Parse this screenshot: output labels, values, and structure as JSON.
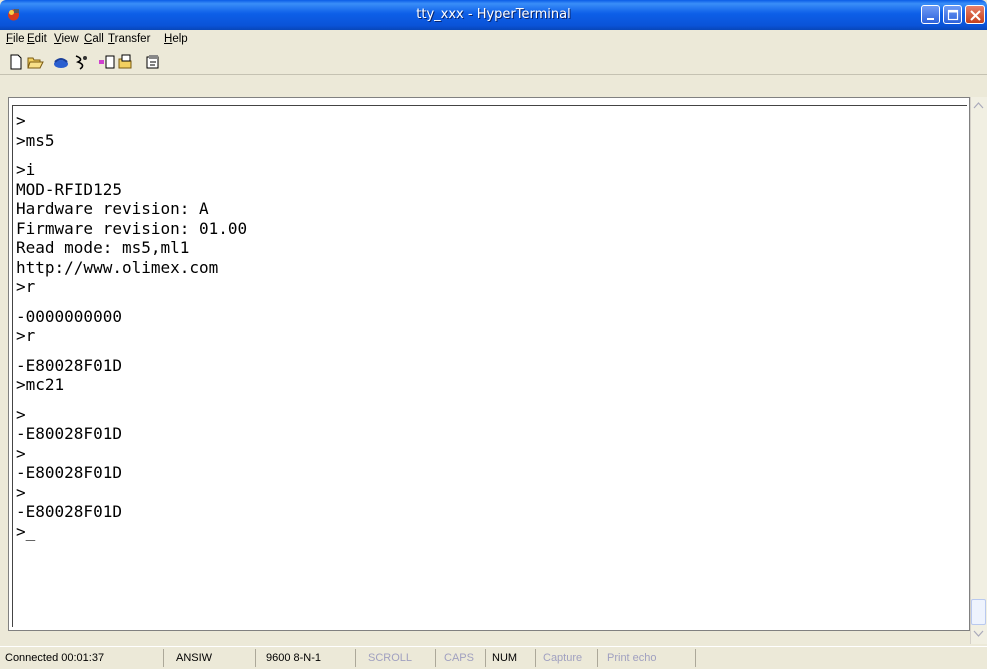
{
  "window": {
    "title": "tty_xxx - HyperTerminal"
  },
  "menu": [
    {
      "label": "File",
      "accel": "F",
      "rest": "ile"
    },
    {
      "label": "Edit",
      "accel": "E",
      "rest": "dit"
    },
    {
      "label": "View",
      "accel": "V",
      "rest": "iew"
    },
    {
      "label": "Call",
      "accel": "C",
      "rest": "all"
    },
    {
      "label": "Transfer",
      "accel": "T",
      "rest": "ransfer"
    },
    {
      "label": "Help",
      "accel": "H",
      "rest": "elp"
    }
  ],
  "toolbar": [
    "new-icon",
    "open-icon",
    "connect-icon",
    "disconnect-icon",
    "send-icon",
    "receive-icon",
    "properties-icon"
  ],
  "terminal": {
    "lines": [
      ">",
      ">ms5",
      "",
      ">i",
      "MOD-RFID125",
      "Hardware revision: A",
      "Firmware revision: 01.00",
      "Read mode: ms5,ml1",
      "http://www.olimex.com",
      ">r",
      "",
      "-0000000000",
      ">r",
      "",
      "-E80028F01D",
      ">mc21",
      "",
      ">",
      "-E80028F01D",
      ">",
      "-E80028F01D",
      ">",
      "-E80028F01D",
      ">_"
    ]
  },
  "status": {
    "connected": "Connected 00:01:37",
    "emulation": "ANSIW",
    "port": "9600 8-N-1",
    "scroll": "SCROLL",
    "caps": "CAPS",
    "num": "NUM",
    "capture": "Capture",
    "print_echo": "Print echo"
  }
}
